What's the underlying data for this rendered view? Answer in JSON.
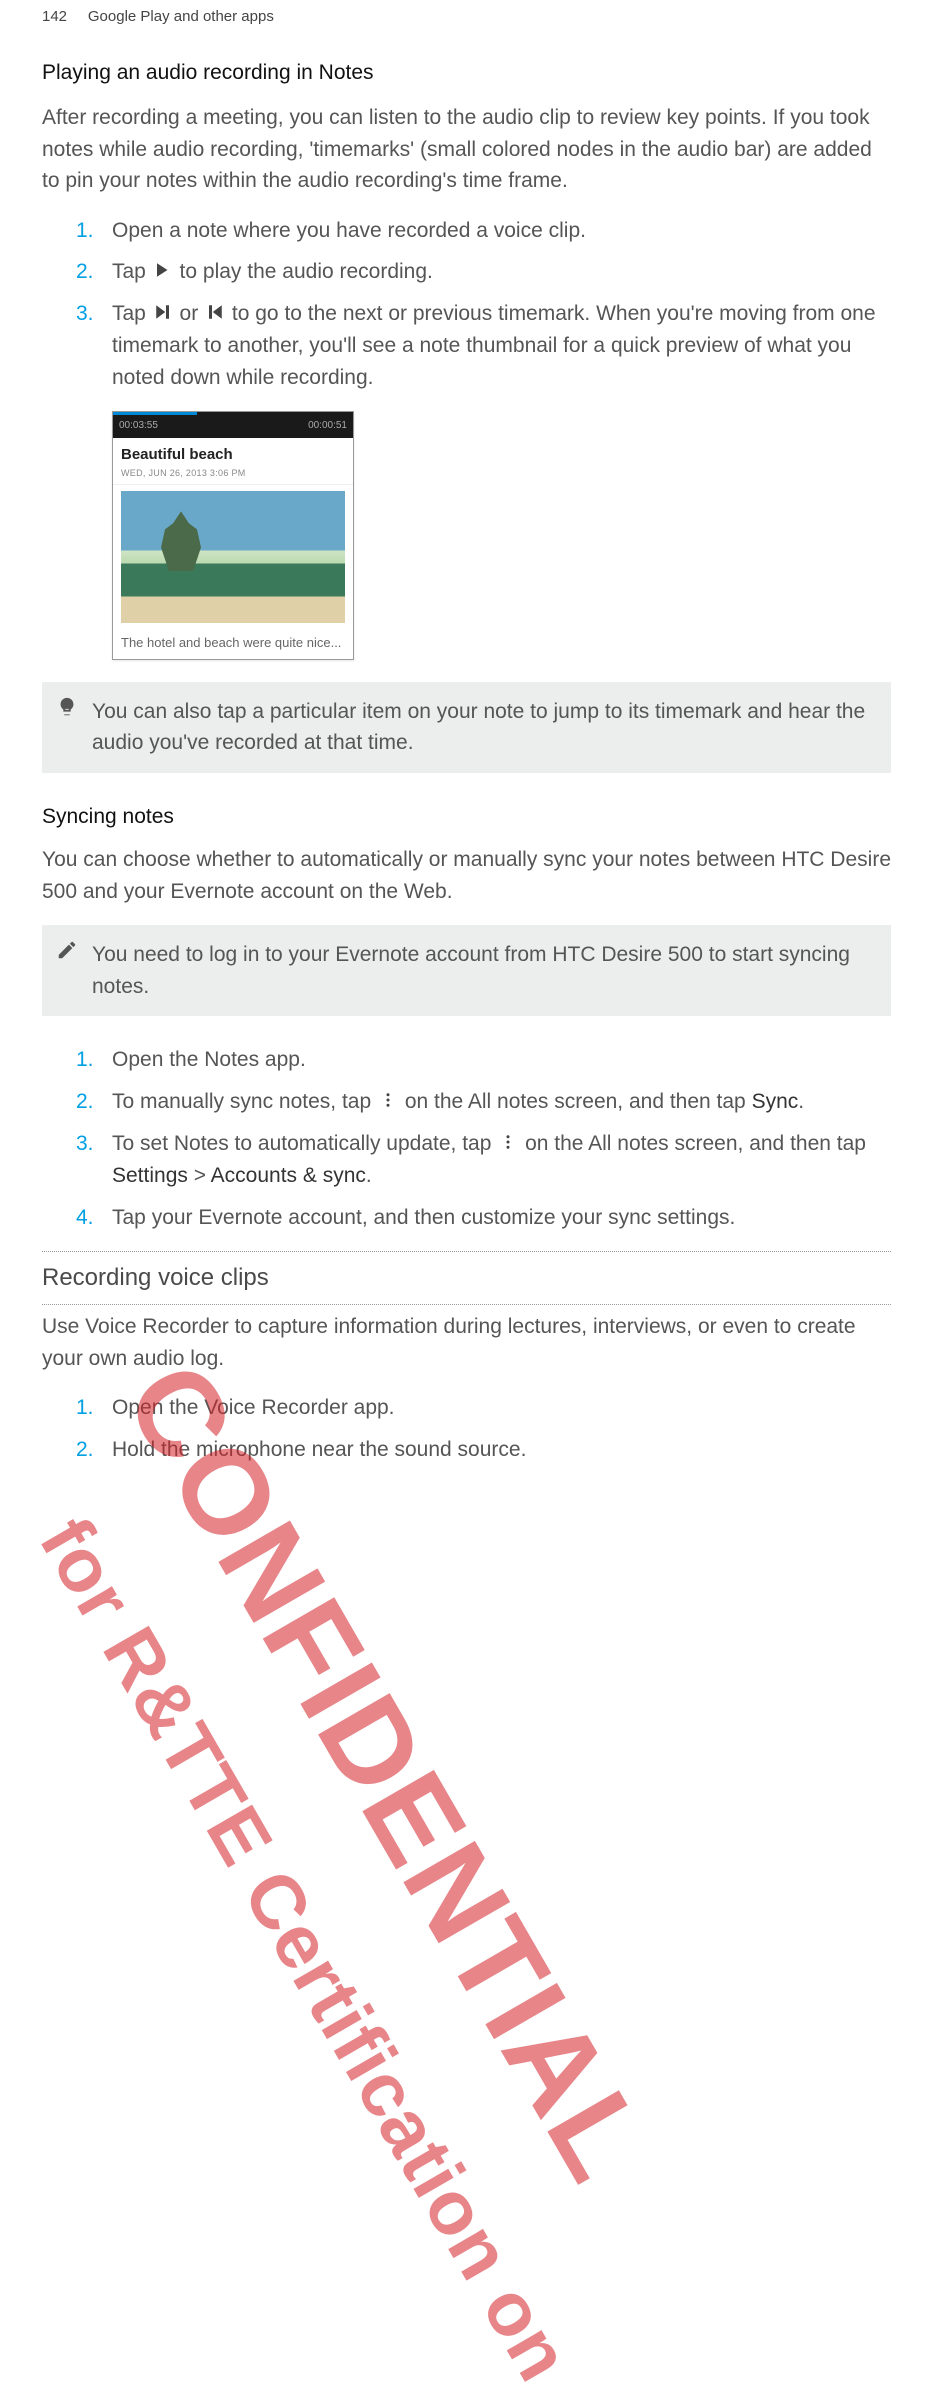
{
  "header": {
    "page_number": "142",
    "chapter": "Google Play and other apps"
  },
  "section1": {
    "title": "Playing an audio recording in Notes",
    "intro": "After recording a meeting, you can listen to the audio clip to review key points. If you took notes while audio recording, 'timemarks' (small colored nodes in the audio bar) are added to pin your notes within the audio recording's time frame.",
    "steps": [
      {
        "n": "1.",
        "text": "Open a note where you have recorded a voice clip."
      },
      {
        "n": "2.",
        "pre": "Tap ",
        "post": " to play the audio recording."
      },
      {
        "n": "3.",
        "pre": "Tap ",
        "mid": " or ",
        "post": " to go to the next or previous timemark. When you're moving from one timemark to another, you'll see a note thumbnail for a quick preview of what you noted down while recording."
      }
    ],
    "thumbnail": {
      "time_left": "00:03:55",
      "time_right": "00:00:51",
      "title": "Beautiful beach",
      "date": "WED, JUN 26, 2013 3:06 PM",
      "footer": "The hotel and beach were quite nice..."
    },
    "tip": "You can also tap a particular item on your note to jump to its timemark and hear the audio you've recorded at that time."
  },
  "section2": {
    "title": "Syncing notes",
    "intro": "You can choose whether to automatically or manually sync your notes between HTC Desire 500 and your Evernote account on the Web.",
    "note": "You need to log in to your Evernote account from HTC Desire 500 to start syncing notes.",
    "steps": [
      {
        "n": "1.",
        "text": "Open the Notes app."
      },
      {
        "n": "2.",
        "pre": "To manually sync notes, tap ",
        "post": " on the All notes screen, and then tap ",
        "bold": "Sync",
        "tail": "."
      },
      {
        "n": "3.",
        "pre": "To set Notes to automatically update, tap ",
        "post": " on the All notes screen, and then tap ",
        "bold": "Settings",
        "gt": " > ",
        "bold2": "Accounts & sync",
        "tail": "."
      },
      {
        "n": "4.",
        "text": "Tap your Evernote account, and then customize your sync settings."
      }
    ]
  },
  "section3": {
    "title": "Recording voice clips",
    "intro": "Use Voice Recorder to capture information during lectures, interviews, or even to create your own audio log.",
    "steps": [
      {
        "n": "1.",
        "text": "Open the Voice Recorder app."
      },
      {
        "n": "2.",
        "text": "Hold the microphone near the sound source."
      }
    ]
  },
  "watermarks": {
    "w1": "CONFIDENTIAL",
    "w2": "for R&TTE Certification on"
  }
}
